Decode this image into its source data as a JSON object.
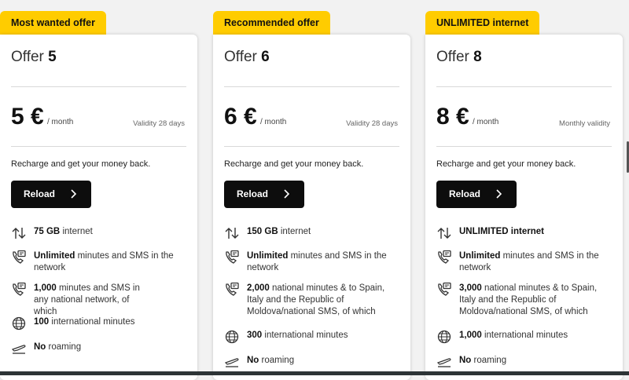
{
  "offers": [
    {
      "badge": "Most wanted offer",
      "title_prefix": "Offer",
      "title_number": "5",
      "price": "5 €",
      "period": "/ month",
      "validity": "Validity 28 days",
      "promo": "Recharge and get your money back.",
      "button_label": "Reload",
      "features": [
        {
          "icon": "data-transfer-icon",
          "bold": "75 GB",
          "text": " internet"
        },
        {
          "icon": "call-sms-icon",
          "bold": "Unlimited",
          "text": " minutes and SMS in the network"
        },
        {
          "icon": "call-sms-icon",
          "bold": "1,000",
          "text": " minutes and SMS in any national network, of which"
        },
        {
          "icon": "globe-icon",
          "bold": "100",
          "text": " international minutes"
        },
        {
          "icon": "airplane-icon",
          "bold": "No",
          "text": " roaming"
        }
      ]
    },
    {
      "badge": "Recommended offer",
      "title_prefix": "Offer",
      "title_number": "6",
      "price": "6 €",
      "period": "/ month",
      "validity": "Validity 28 days",
      "promo": "Recharge and get your money back.",
      "button_label": "Reload",
      "features": [
        {
          "icon": "data-transfer-icon",
          "bold": "150 GB",
          "text": " internet"
        },
        {
          "icon": "call-sms-icon",
          "bold": "Unlimited",
          "text": " minutes and SMS in the network"
        },
        {
          "icon": "call-sms-icon",
          "bold": "2,000",
          "text": " national minutes & to Spain, Italy and the Republic of Moldova/national SMS, of which"
        },
        {
          "icon": "globe-icon",
          "bold": "300",
          "text": " international minutes"
        },
        {
          "icon": "airplane-icon",
          "bold": "No",
          "text": " roaming"
        }
      ]
    },
    {
      "badge": "UNLIMITED internet",
      "title_prefix": "Offer",
      "title_number": "8",
      "price": "8 €",
      "period": "/ month",
      "validity": "Monthly validity",
      "promo": "Recharge and get your money back.",
      "button_label": "Reload",
      "features": [
        {
          "icon": "data-transfer-icon",
          "bold": "UNLIMITED internet",
          "text": ""
        },
        {
          "icon": "call-sms-icon",
          "bold": "Unlimited",
          "text": " minutes and SMS in the network"
        },
        {
          "icon": "call-sms-icon",
          "bold": "3,000",
          "text": " national minutes & to Spain, Italy and the Republic of Moldova/national SMS, of which"
        },
        {
          "icon": "globe-icon",
          "bold": "1,000",
          "text": " international minutes"
        },
        {
          "icon": "airplane-icon",
          "bold": "No",
          "text": " roaming"
        }
      ]
    }
  ],
  "colors": {
    "badge": "#ffcc00",
    "button": "#0d0d0d",
    "card": "#ffffff",
    "background": "#f2f2f2"
  }
}
